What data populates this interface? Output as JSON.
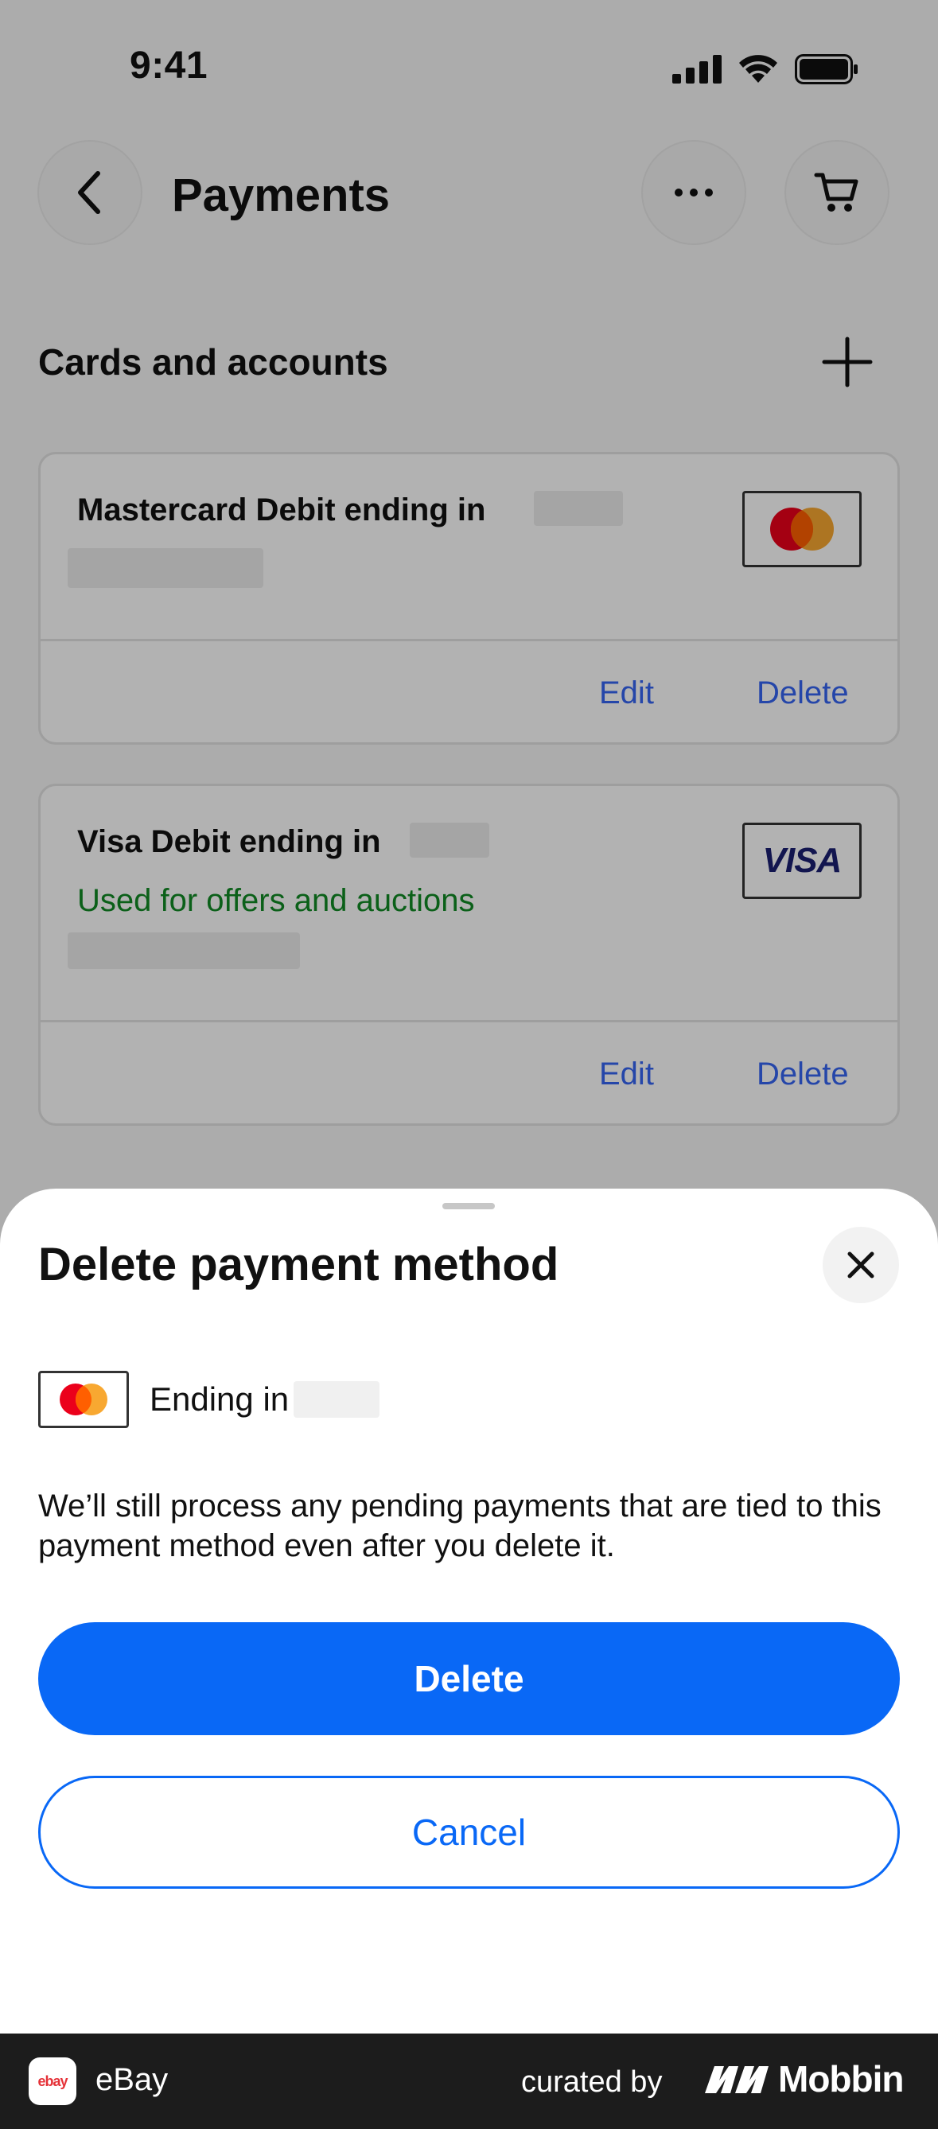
{
  "status_bar": {
    "time": "9:41"
  },
  "header": {
    "title": "Payments"
  },
  "section": {
    "title": "Cards and accounts"
  },
  "cards": [
    {
      "title": "Mastercard Debit ending in",
      "subtitle": "",
      "edit_label": "Edit",
      "delete_label": "Delete",
      "brand": "mastercard"
    },
    {
      "title": "Visa Debit ending in",
      "subtitle": "Used for offers and auctions",
      "edit_label": "Edit",
      "delete_label": "Delete",
      "brand": "visa",
      "brand_text": "VISA"
    }
  ],
  "sheet": {
    "title": "Delete payment method",
    "ending_label": "Ending in",
    "body": "We’ll still process any pending payments that are tied to this payment method even after you delete it.",
    "delete_label": "Delete",
    "cancel_label": "Cancel"
  },
  "footer": {
    "app_name": "eBay",
    "app_icon_text": "ebay",
    "curated_by": "curated by",
    "brand": "Mobbin"
  },
  "colors": {
    "primary": "#0968f6",
    "link": "#3665f3",
    "success": "#118a24",
    "mc_red": "#eb001b",
    "mc_orange": "#f79e1b"
  }
}
